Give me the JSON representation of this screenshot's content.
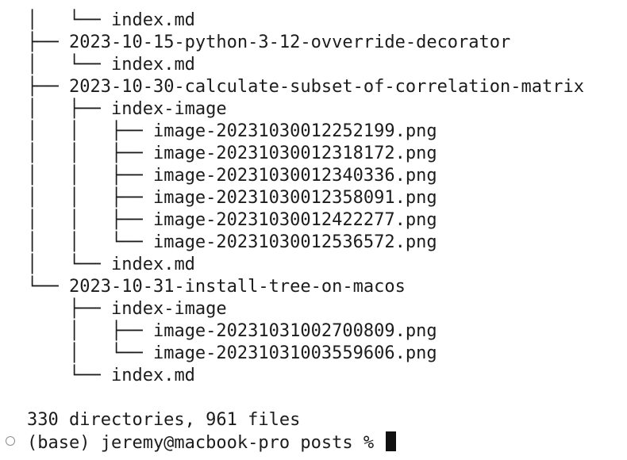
{
  "terminal": {
    "lines": [
      {
        "prefix": "│   └── ",
        "name": "index.md"
      },
      {
        "prefix": "├── ",
        "name": "2023-10-15-python-3-12-ovverride-decorator"
      },
      {
        "prefix": "│   └── ",
        "name": "index.md"
      },
      {
        "prefix": "├── ",
        "name": "2023-10-30-calculate-subset-of-correlation-matrix"
      },
      {
        "prefix": "│   ├── ",
        "name": "index-image"
      },
      {
        "prefix": "│   │   ├── ",
        "name": "image-20231030012252199.png"
      },
      {
        "prefix": "│   │   ├── ",
        "name": "image-20231030012318172.png"
      },
      {
        "prefix": "│   │   ├── ",
        "name": "image-20231030012340336.png"
      },
      {
        "prefix": "│   │   ├── ",
        "name": "image-20231030012358091.png"
      },
      {
        "prefix": "│   │   ├── ",
        "name": "image-20231030012422277.png"
      },
      {
        "prefix": "│   │   └── ",
        "name": "image-20231030012536572.png"
      },
      {
        "prefix": "│   └── ",
        "name": "index.md"
      },
      {
        "prefix": "└── ",
        "name": "2023-10-31-install-tree-on-macos"
      },
      {
        "prefix": "    ├── ",
        "name": "index-image"
      },
      {
        "prefix": "    │   ├── ",
        "name": "image-20231031002700809.png"
      },
      {
        "prefix": "    │   └── ",
        "name": "image-20231031003559606.png"
      },
      {
        "prefix": "    └── ",
        "name": "index.md"
      }
    ],
    "summary": "330 directories, 961 files",
    "prompt": "(base) jeremy@macbook-pro posts % ",
    "prompt_marker_icon": "circle-outline-icon"
  }
}
